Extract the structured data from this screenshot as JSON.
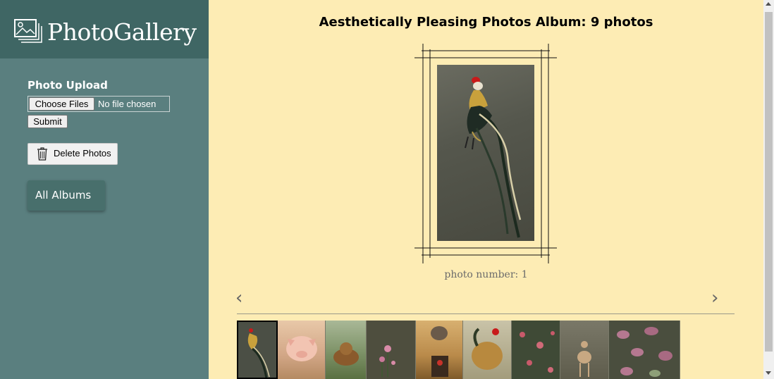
{
  "brand": {
    "title": "PhotoGallery",
    "icon": "gallery-icon"
  },
  "sidebar": {
    "upload_label": "Photo Upload",
    "choose_files_label": "Choose Files",
    "no_file_text": "No file chosen",
    "submit_label": "Submit",
    "delete_label": "Delete Photos",
    "delete_icon": "trash-icon",
    "albums_label": "All Albums"
  },
  "main": {
    "album_title": "Aesthetically Pleasing Photos Album: 9 photos",
    "photo_number": "photo number: 1",
    "prev_arrow": "‹",
    "next_arrow": "›",
    "selected_index": 1
  },
  "thumbnails": [
    {
      "name": "rooster",
      "active": true
    },
    {
      "name": "pig"
    },
    {
      "name": "bear"
    },
    {
      "name": "flowers-dark"
    },
    {
      "name": "train"
    },
    {
      "name": "rooster-hen"
    },
    {
      "name": "roses"
    },
    {
      "name": "deer"
    },
    {
      "name": "pink-leaves"
    }
  ],
  "colors": {
    "sidebar": "#5a7f7f",
    "brand_bar": "#3f6664",
    "background": "#fdecb4",
    "albums_button": "#486f6c"
  }
}
